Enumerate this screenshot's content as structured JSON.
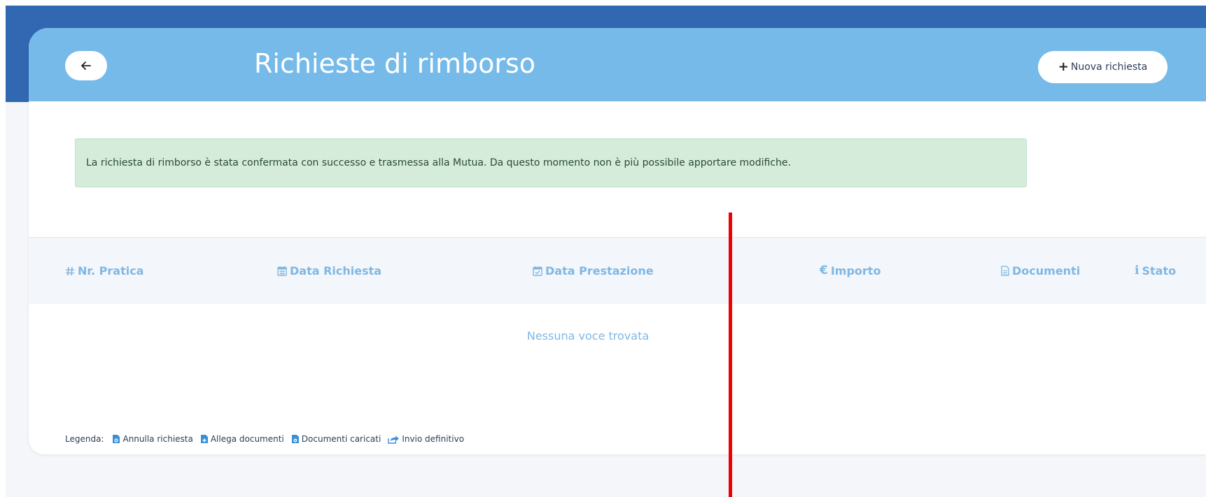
{
  "header": {
    "title": "Richieste di rimborso",
    "new_request_label": "Nuova richiesta"
  },
  "alert": {
    "message": "La richiesta di rimborso è stata confermata con successo e trasmessa alla Mutua. Da questo momento non è più possibile apportare modifiche."
  },
  "table": {
    "columns": [
      {
        "label": "Nr. Pratica",
        "icon": "hashtag-icon"
      },
      {
        "label": "Data Richiesta",
        "icon": "calendar-icon"
      },
      {
        "label": "Data Prestazione",
        "icon": "calendar-check-icon"
      },
      {
        "label": "Importo",
        "icon": "euro-icon"
      },
      {
        "label": "Documenti",
        "icon": "file-icon"
      },
      {
        "label": "Stato",
        "icon": "info-icon"
      }
    ],
    "empty_message": "Nessuna voce trovata"
  },
  "legend": {
    "label": "Legenda:",
    "items": [
      {
        "label": "Annulla richiesta",
        "icon": "cancel-document-icon"
      },
      {
        "label": "Allega documenti",
        "icon": "attach-document-icon"
      },
      {
        "label": "Documenti caricati",
        "icon": "uploaded-documents-icon"
      },
      {
        "label": "Invio definitivo",
        "icon": "send-share-icon"
      }
    ]
  },
  "colors": {
    "top_bar": "#3268b2",
    "card_header": "#76bae9",
    "alert_background": "#d5ecda",
    "column_header_text": "#7fb7e4",
    "legend_icon": "#3a8fd6",
    "annotation_line": "#ee0000"
  }
}
